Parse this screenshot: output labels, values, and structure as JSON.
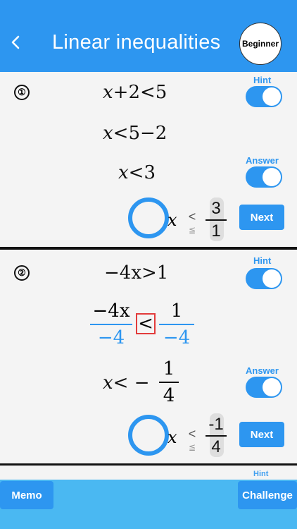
{
  "header": {
    "back_icon": "chevron-left-icon",
    "title": "Linear inequalities",
    "level": "Beginner",
    "color": "#2d96f0"
  },
  "problems": [
    {
      "number": "①",
      "steps": [
        "x + 2 < 5",
        "x < 5 − 2",
        "x < 3"
      ],
      "hint_label": "Hint",
      "answer_label": "Answer",
      "hint_on": true,
      "answer_on": true,
      "answer_var": "x",
      "symbol_options": [
        "<",
        "≦"
      ],
      "fraction": {
        "numerator": "3",
        "denominator": "1"
      },
      "next_label": "Next"
    },
    {
      "number": "②",
      "step1": {
        "left": "−4x",
        "op": ">",
        "right": "1"
      },
      "step2": {
        "left_num": "−4x",
        "left_den": "−4",
        "op": "<",
        "right_num": "1",
        "right_den": "−4"
      },
      "step3": {
        "left": "x",
        "op": "< −",
        "frac_num": "1",
        "frac_den": "4"
      },
      "hint_label": "Hint",
      "answer_label": "Answer",
      "hint_on": true,
      "answer_on": true,
      "answer_var": "x",
      "symbol_options": [
        "<",
        "≦"
      ],
      "fraction": {
        "numerator": "-1",
        "denominator": "4"
      },
      "next_label": "Next"
    }
  ],
  "peek_label": "Hint",
  "footer": {
    "memo_label": "Memo",
    "challenge_label": "Challenge"
  }
}
